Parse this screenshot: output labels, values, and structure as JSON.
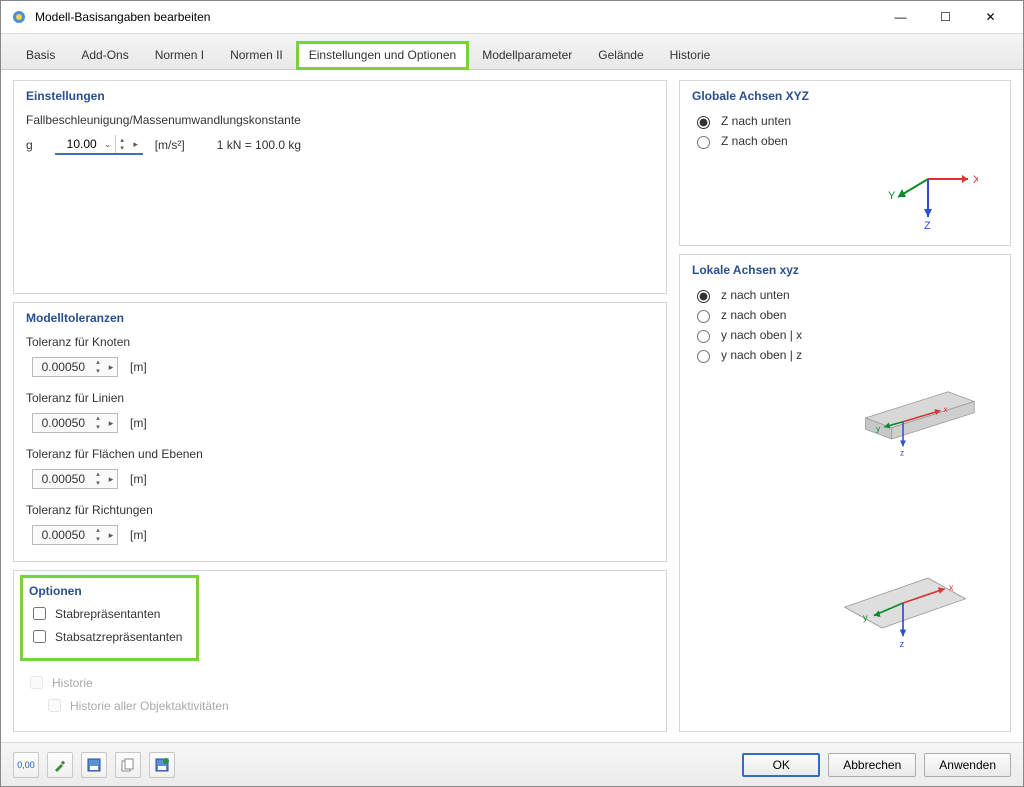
{
  "window": {
    "title": "Modell-Basisangaben bearbeiten"
  },
  "tabs": [
    "Basis",
    "Add-Ons",
    "Normen I",
    "Normen II",
    "Einstellungen und Optionen",
    "Modellparameter",
    "Gelände",
    "Historie"
  ],
  "activeTab": 4,
  "settings": {
    "panel_title": "Einstellungen",
    "accel_label": "Fallbeschleunigung/Massenumwandlungskonstante",
    "g_symbol": "g",
    "g_value": "10.00",
    "g_unit": "[m/s²]",
    "g_note": "1 kN = 100.0 kg"
  },
  "tolerances": {
    "panel_title": "Modelltoleranzen",
    "items": [
      {
        "label": "Toleranz für Knoten",
        "value": "0.00050",
        "unit": "[m]"
      },
      {
        "label": "Toleranz für Linien",
        "value": "0.00050",
        "unit": "[m]"
      },
      {
        "label": "Toleranz für Flächen und Ebenen",
        "value": "0.00050",
        "unit": "[m]"
      },
      {
        "label": "Toleranz für Richtungen",
        "value": "0.00050",
        "unit": "[m]"
      }
    ]
  },
  "options": {
    "panel_title": "Optionen",
    "stab": "Stabrepräsentanten",
    "stabsatz": "Stabsatzrepräsentanten",
    "historie": "Historie",
    "historie_all": "Historie aller Objektaktivitäten"
  },
  "globalAxes": {
    "panel_title": "Globale Achsen XYZ",
    "opts": [
      "Z nach unten",
      "Z nach oben"
    ],
    "selected": 0
  },
  "localAxes": {
    "panel_title": "Lokale Achsen xyz",
    "opts": [
      "z nach unten",
      "z nach oben",
      "y nach oben | x",
      "y nach oben | z"
    ],
    "selected": 0
  },
  "footer": {
    "tool_icons": [
      "0,00",
      "brush-icon",
      "disk-icon",
      "copy-icon",
      "disk2-icon"
    ],
    "ok": "OK",
    "cancel": "Abbrechen",
    "apply": "Anwenden"
  }
}
